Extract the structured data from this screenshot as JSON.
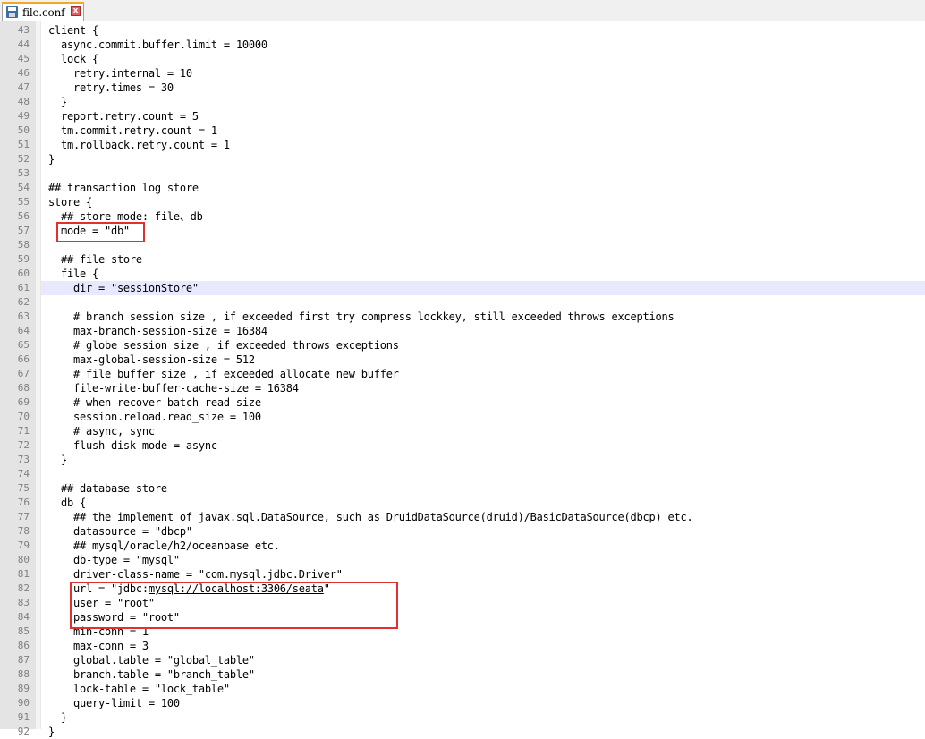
{
  "tab": {
    "filename": "file.conf",
    "close_glyph": "x"
  },
  "editor": {
    "current_line": 61,
    "lines": [
      {
        "n": "43",
        "text": "client {"
      },
      {
        "n": "44",
        "text": "  async.commit.buffer.limit = 10000"
      },
      {
        "n": "45",
        "text": "  lock {"
      },
      {
        "n": "46",
        "text": "    retry.internal = 10"
      },
      {
        "n": "47",
        "text": "    retry.times = 30"
      },
      {
        "n": "48",
        "text": "  }"
      },
      {
        "n": "49",
        "text": "  report.retry.count = 5"
      },
      {
        "n": "50",
        "text": "  tm.commit.retry.count = 1"
      },
      {
        "n": "51",
        "text": "  tm.rollback.retry.count = 1"
      },
      {
        "n": "52",
        "text": "}"
      },
      {
        "n": "53",
        "text": ""
      },
      {
        "n": "54",
        "text": "## transaction log store"
      },
      {
        "n": "55",
        "text": "store {"
      },
      {
        "n": "56",
        "text": "  ## store mode: file、db"
      },
      {
        "n": "57",
        "text": "  mode = \"db\""
      },
      {
        "n": "58",
        "text": ""
      },
      {
        "n": "59",
        "text": "  ## file store"
      },
      {
        "n": "60",
        "text": "  file {"
      },
      {
        "n": "61",
        "text": "    dir = \"sessionStore\""
      },
      {
        "n": "62",
        "text": ""
      },
      {
        "n": "63",
        "text": "    # branch session size , if exceeded first try compress lockkey, still exceeded throws exceptions"
      },
      {
        "n": "64",
        "text": "    max-branch-session-size = 16384"
      },
      {
        "n": "65",
        "text": "    # globe session size , if exceeded throws exceptions"
      },
      {
        "n": "66",
        "text": "    max-global-session-size = 512"
      },
      {
        "n": "67",
        "text": "    # file buffer size , if exceeded allocate new buffer"
      },
      {
        "n": "68",
        "text": "    file-write-buffer-cache-size = 16384"
      },
      {
        "n": "69",
        "text": "    # when recover batch read size"
      },
      {
        "n": "70",
        "text": "    session.reload.read_size = 100"
      },
      {
        "n": "71",
        "text": "    # async, sync"
      },
      {
        "n": "72",
        "text": "    flush-disk-mode = async"
      },
      {
        "n": "73",
        "text": "  }"
      },
      {
        "n": "74",
        "text": ""
      },
      {
        "n": "75",
        "text": "  ## database store"
      },
      {
        "n": "76",
        "text": "  db {"
      },
      {
        "n": "77",
        "text": "    ## the implement of javax.sql.DataSource, such as DruidDataSource(druid)/BasicDataSource(dbcp) etc."
      },
      {
        "n": "78",
        "text": "    datasource = \"dbcp\""
      },
      {
        "n": "79",
        "text": "    ## mysql/oracle/h2/oceanbase etc."
      },
      {
        "n": "80",
        "text": "    db-type = \"mysql\""
      },
      {
        "n": "81",
        "text": "    driver-class-name = \"com.mysql.jdbc.Driver\""
      },
      {
        "n": "82",
        "text": "",
        "url_prefix": "    url = \"jdbc:",
        "url_link": "mysql://localhost:3306/seata",
        "url_suffix": "\""
      },
      {
        "n": "83",
        "text": "    user = \"root\""
      },
      {
        "n": "84",
        "text": "    password = \"root\""
      },
      {
        "n": "85",
        "text": "    min-conn = 1"
      },
      {
        "n": "86",
        "text": "    max-conn = 3"
      },
      {
        "n": "87",
        "text": "    global.table = \"global_table\""
      },
      {
        "n": "88",
        "text": "    branch.table = \"branch_table\""
      },
      {
        "n": "89",
        "text": "    lock-table = \"lock_table\""
      },
      {
        "n": "90",
        "text": "    query-limit = 100"
      },
      {
        "n": "91",
        "text": "  }"
      },
      {
        "n": "92",
        "text": "}"
      }
    ]
  },
  "colors": {
    "highlight_box": "#e03030",
    "current_line_bg": "#e8e8ff",
    "gutter_bg": "#e4e4e4",
    "tab_accent": "#f5a623"
  },
  "icons": {
    "tab_icon": "save-icon",
    "tab_close": "close-icon"
  }
}
